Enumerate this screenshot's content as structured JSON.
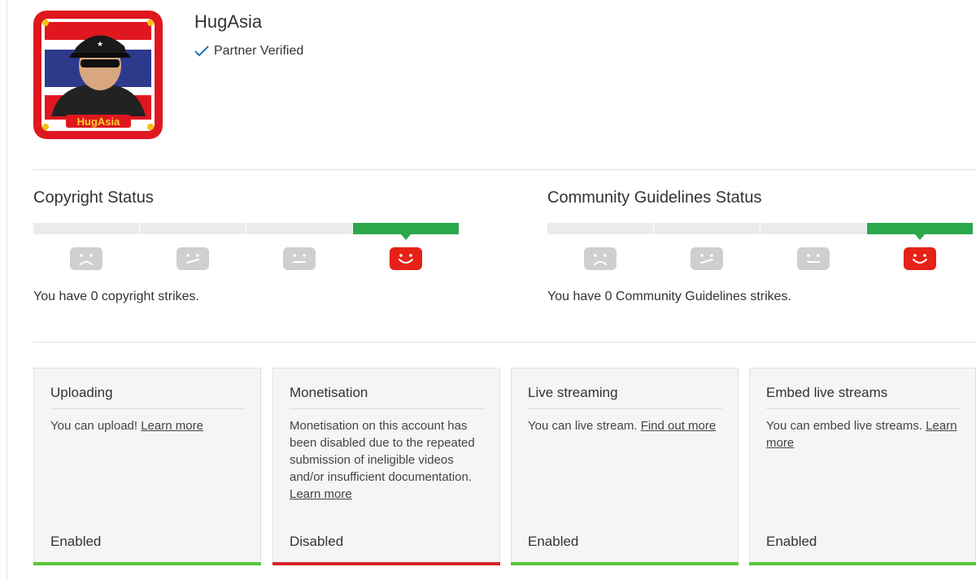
{
  "channel": {
    "name": "HugAsia",
    "verified_label": "Partner Verified",
    "thumbnail_text": "HugAsia"
  },
  "copyright": {
    "title": "Copyright Status",
    "message": "You have 0 copyright strikes.",
    "level": 4
  },
  "community": {
    "title": "Community Guidelines Status",
    "message": "You have 0 Community Guidelines strikes.",
    "level": 4
  },
  "colors": {
    "green": "#2ba84a",
    "red": "#e62117",
    "enabled_stripe": "#57c736",
    "disabled_stripe": "#d62525"
  },
  "cards": [
    {
      "title": "Uploading",
      "text": "You can upload! ",
      "link": "Learn more",
      "status": "Enabled"
    },
    {
      "title": "Monetisation",
      "text": "Monetisation on this account has been disabled due to the repeated submission of ineligible videos and/or insufficient documentation. ",
      "link": "Learn more",
      "status": "Disabled"
    },
    {
      "title": "Live streaming",
      "text": "You can live stream. ",
      "link": "Find out more",
      "status": "Enabled"
    },
    {
      "title": "Embed live streams",
      "text": "You can embed live streams. ",
      "link": "Learn more",
      "status": "Enabled"
    }
  ]
}
